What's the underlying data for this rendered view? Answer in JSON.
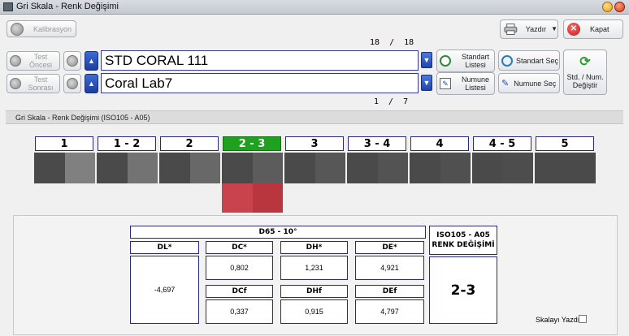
{
  "window": {
    "title": "Gri Skala - Renk Değişimi"
  },
  "toolbar": {
    "calibration_label": "Kalibrasyon",
    "print_label": "Yazdır",
    "close_label": "Kapat"
  },
  "standard": {
    "counter": "18  /  18",
    "prev_label": "Test Öncesi",
    "value": "STD CORAL 111",
    "list_label": "Standart Listesi",
    "select_label": "Standart Seç"
  },
  "sample": {
    "counter": "1  /  7",
    "prev_label": "Test Sonrası",
    "value": "Coral Lab7",
    "list_label": "Numune Listesi",
    "select_label": "Numune Seç"
  },
  "swap_label": "Std. / Num. Değiştir",
  "section_title": "Gri Skala - Renk Değişimi (ISO105 - A05)",
  "scale": {
    "grades": [
      "1",
      "1 - 2",
      "2",
      "2 - 3",
      "3",
      "3 - 4",
      "4",
      "4 - 5",
      "5"
    ],
    "selected_index": 3,
    "left_color": "#4a4a4a",
    "right_colors": [
      "#808080",
      "#737373",
      "#686868",
      "#5c5c5c",
      "#575757",
      "#535353",
      "#505050",
      "#4d4d4d",
      "#4a4a4a"
    ],
    "sample_left_color": "#c9434c",
    "sample_right_color": "#b9363f"
  },
  "results": {
    "illuminant": "D65 - 10°",
    "dl_label": "DL*",
    "dl_value": "-4,697",
    "dc_label": "DC*",
    "dc_value": "0,802",
    "dh_label": "DH*",
    "dh_value": "1,231",
    "de_label": "DE*",
    "de_value": "4,921",
    "dcf_label": "DCf",
    "dcf_value": "0,337",
    "dhf_label": "DHf",
    "dhf_value": "0,915",
    "def_label": "DEf",
    "def_value": "4,797",
    "iso_title_1": "ISO105 - A05",
    "iso_title_2": "RENK DEĞİŞİMİ",
    "iso_grade": "2-3"
  },
  "print_scale_label": "Skalayı Yazdır"
}
